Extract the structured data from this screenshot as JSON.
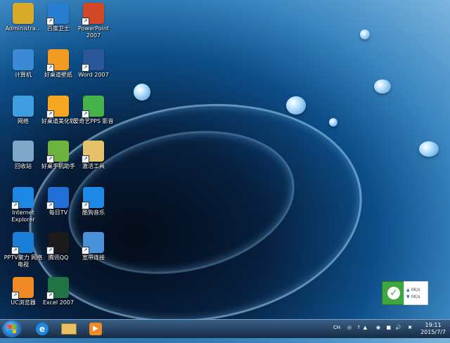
{
  "desktop": {
    "icons": [
      {
        "label": "Administra...",
        "icon": "user-folder-icon",
        "color": "#d9a928"
      },
      {
        "label": "百度卫士",
        "icon": "shield-icon",
        "color": "#2a7ed2"
      },
      {
        "label": "PowerPoint 2007",
        "icon": "powerpoint-icon",
        "color": "#d24726"
      },
      {
        "label": "计算机",
        "icon": "computer-icon",
        "color": "#3b8ad6"
      },
      {
        "label": "好桌道壁纸",
        "icon": "wallpaper-app-icon",
        "color": "#f29b21"
      },
      {
        "label": "Word 2007",
        "icon": "word-icon",
        "color": "#2b579a"
      },
      {
        "label": "网络",
        "icon": "network-icon",
        "color": "#3f9de0"
      },
      {
        "label": "好桌道美化软",
        "icon": "beautify-app-icon",
        "color": "#f5a623"
      },
      {
        "label": "爱奇艺PPS 影音",
        "icon": "iqiyi-icon",
        "color": "#46b34a"
      },
      {
        "label": "回收站",
        "icon": "recycle-bin-icon",
        "color": "#7ea8c9"
      },
      {
        "label": "好桌手机助手",
        "icon": "phone-assistant-icon",
        "color": "#6db33f"
      },
      {
        "label": "激活工具",
        "icon": "folder-icon",
        "color": "#e5c26a"
      },
      {
        "label": "Internet Explorer",
        "icon": "ie-icon",
        "color": "#1e88e5"
      },
      {
        "label": "每日TV",
        "icon": "tv-app-icon",
        "color": "#1f6fd6"
      },
      {
        "label": "酷狗音乐",
        "icon": "kugou-icon",
        "color": "#1e88e5"
      },
      {
        "label": "PPTV聚力 网络电视",
        "icon": "pptv-icon",
        "color": "#1a7fd8"
      },
      {
        "label": "腾讯QQ",
        "icon": "qq-icon",
        "color": "#1b1b1b"
      },
      {
        "label": "宽带连接",
        "icon": "broadband-icon",
        "color": "#4a90d9"
      },
      {
        "label": "UC浏览器",
        "icon": "uc-browser-icon",
        "color": "#f08a24"
      },
      {
        "label": "Excel 2007",
        "icon": "excel-icon",
        "color": "#217346"
      }
    ]
  },
  "taskbar": {
    "pinned": [
      {
        "name": "ie-icon"
      },
      {
        "name": "explorer-icon"
      },
      {
        "name": "media-player-icon"
      }
    ],
    "tray": {
      "ime": "CH",
      "clock_time": "19:11",
      "clock_date": "2015/7/7"
    }
  },
  "widget": {
    "up_speed": "0K/s",
    "down_speed": "0K/s"
  }
}
